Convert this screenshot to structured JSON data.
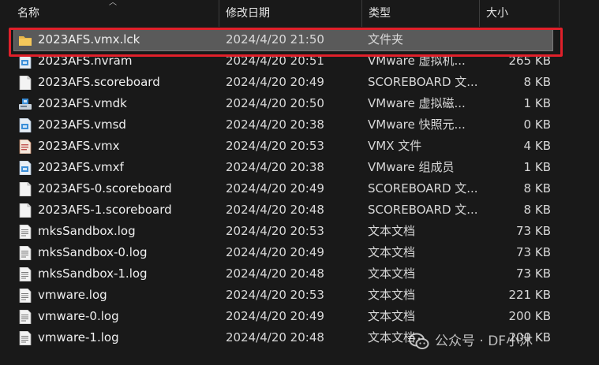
{
  "columns": {
    "name": "名称",
    "date": "修改日期",
    "type": "类型",
    "size": "大小"
  },
  "files": [
    {
      "icon": "folder-icon",
      "name": "2023AFS.vmx.lck",
      "date": "2024/4/20 21:50",
      "type": "文件夹",
      "size": "",
      "selected": true
    },
    {
      "icon": "vmware-file-icon",
      "name": "2023AFS.nvram",
      "date": "2024/4/20 20:51",
      "type": "VMware 虚拟机...",
      "size": "265 KB"
    },
    {
      "icon": "blank-file-icon",
      "name": "2023AFS.scoreboard",
      "date": "2024/4/20 20:49",
      "type": "SCOREBOARD 文...",
      "size": "8 KB"
    },
    {
      "icon": "disk-file-icon",
      "name": "2023AFS.vmdk",
      "date": "2024/4/20 20:50",
      "type": "VMware 虚拟磁...",
      "size": "1 KB"
    },
    {
      "icon": "vmware-file-icon",
      "name": "2023AFS.vmsd",
      "date": "2024/4/20 20:38",
      "type": "VMware 快照元...",
      "size": "0 KB"
    },
    {
      "icon": "config-file-icon",
      "name": "2023AFS.vmx",
      "date": "2024/4/20 20:53",
      "type": "VMX 文件",
      "size": "4 KB"
    },
    {
      "icon": "vmware-file-icon",
      "name": "2023AFS.vmxf",
      "date": "2024/4/20 20:38",
      "type": "VMware 组成员",
      "size": "1 KB"
    },
    {
      "icon": "blank-file-icon",
      "name": "2023AFS-0.scoreboard",
      "date": "2024/4/20 20:49",
      "type": "SCOREBOARD 文...",
      "size": "8 KB"
    },
    {
      "icon": "blank-file-icon",
      "name": "2023AFS-1.scoreboard",
      "date": "2024/4/20 20:48",
      "type": "SCOREBOARD 文...",
      "size": "8 KB"
    },
    {
      "icon": "text-file-icon",
      "name": "mksSandbox.log",
      "date": "2024/4/20 20:53",
      "type": "文本文档",
      "size": "73 KB"
    },
    {
      "icon": "text-file-icon",
      "name": "mksSandbox-0.log",
      "date": "2024/4/20 20:49",
      "type": "文本文档",
      "size": "73 KB"
    },
    {
      "icon": "text-file-icon",
      "name": "mksSandbox-1.log",
      "date": "2024/4/20 20:48",
      "type": "文本文档",
      "size": "73 KB"
    },
    {
      "icon": "text-file-icon",
      "name": "vmware.log",
      "date": "2024/4/20 20:53",
      "type": "文本文档",
      "size": "221 KB"
    },
    {
      "icon": "text-file-icon",
      "name": "vmware-0.log",
      "date": "2024/4/20 20:49",
      "type": "文本文档",
      "size": "200 KB"
    },
    {
      "icon": "text-file-icon",
      "name": "vmware-1.log",
      "date": "2024/4/20 20:48",
      "type": "文本文档",
      "size": "200 KB"
    }
  ],
  "watermark": {
    "text": "公众号 · DF小沐"
  },
  "colors": {
    "background": "#191919",
    "selection": "#5a5a5a",
    "highlight_border": "#e0202a",
    "folder": "#e8b64a",
    "vmware_blue": "#3c8fd8"
  }
}
